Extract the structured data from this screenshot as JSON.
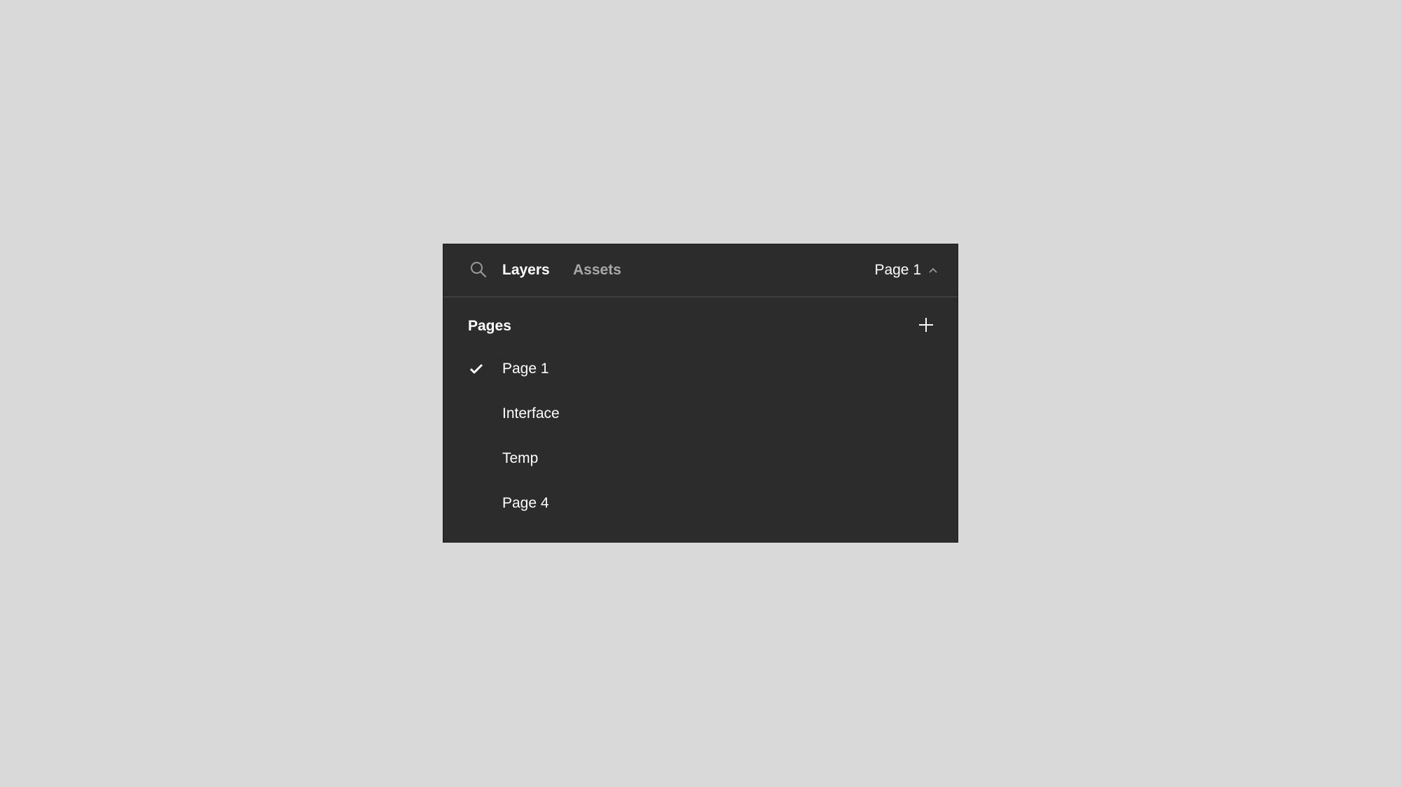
{
  "header": {
    "tabs": [
      {
        "label": "Layers",
        "active": true
      },
      {
        "label": "Assets",
        "active": false
      }
    ],
    "current_page": "Page 1"
  },
  "pages_section": {
    "title": "Pages",
    "items": [
      {
        "label": "Page 1",
        "selected": true
      },
      {
        "label": "Interface",
        "selected": false
      },
      {
        "label": "Temp",
        "selected": false
      },
      {
        "label": "Page 4",
        "selected": false
      }
    ]
  },
  "icons": {
    "search": "search-icon",
    "chevron": "chevron-up-icon",
    "add": "plus-icon",
    "selected": "check-icon"
  },
  "colors": {
    "panel_bg": "#2c2c2c",
    "page_bg": "#d9d9d9",
    "text_primary": "#ffffff",
    "text_secondary": "#a8a8a8"
  }
}
